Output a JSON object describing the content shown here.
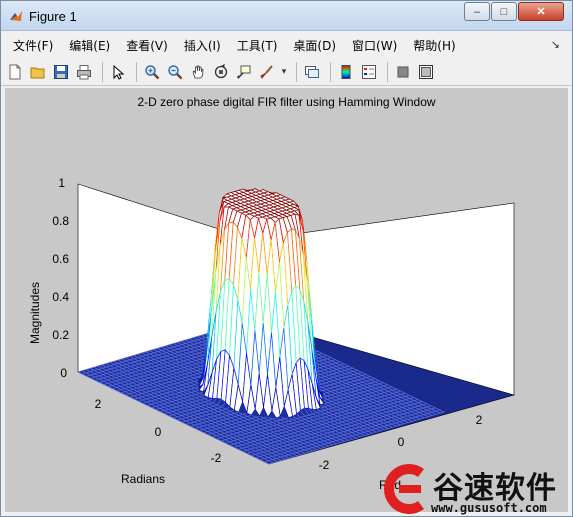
{
  "window": {
    "title": "Figure 1",
    "minimize_glyph": "–",
    "maximize_glyph": "□",
    "close_glyph": "✕"
  },
  "menubar": {
    "items": [
      "文件(F)",
      "编辑(E)",
      "查看(V)",
      "插入(I)",
      "工具(T)",
      "桌面(D)",
      "窗口(W)",
      "帮助(H)"
    ],
    "overflow_glyph": "↘"
  },
  "toolbar": {
    "icons": [
      "new-figure-icon",
      "open-file-icon",
      "save-icon",
      "print-icon",
      "select-arrow-icon",
      "zoom-in-icon",
      "zoom-out-icon",
      "pan-icon",
      "rotate-3d-icon",
      "data-cursor-icon",
      "brush-icon",
      "link-plot-icon",
      "colorbar-icon",
      "legend-icon",
      "hide-plot-tools-icon",
      "show-plot-tools-icon"
    ]
  },
  "chart_data": {
    "type": "surface",
    "title": "2-D zero phase digital FIR filter using Hamming Window",
    "zlabel": "Magnitudes",
    "xlabel": "Radians",
    "ylabel": "Rad",
    "zlim": [
      0,
      1
    ],
    "ztick_labels": [
      "0",
      "0.2",
      "0.4",
      "0.6",
      "0.8",
      "1"
    ],
    "x_tick_labels": [
      "2",
      "0",
      "-2"
    ],
    "y_tick_labels": [
      "-2",
      "0",
      "2"
    ],
    "xlim": [
      -3.14,
      3.14
    ],
    "ylim": [
      -3.14,
      3.14
    ],
    "description_of_surface": {
      "shape": "circular lowpass",
      "passband_radius_rad": 1.2,
      "passband_magnitude": 1.0,
      "stopband_magnitude": 0.0,
      "colormap": "jet",
      "grid": true
    }
  },
  "watermark": {
    "brand": "谷速软件",
    "url": "www.gususoft.com",
    "accent_color": "#e02020"
  }
}
